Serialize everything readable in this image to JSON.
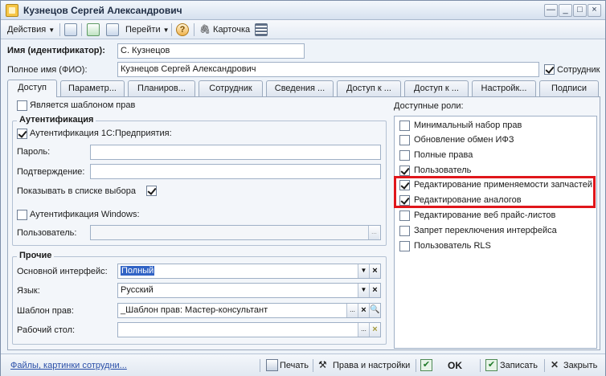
{
  "window": {
    "title": "Кузнецов Сергей Александрович",
    "controls": [
      "_",
      "□",
      "×"
    ],
    "extra_control": "—"
  },
  "toolbar": {
    "actions_label": "Действия",
    "goto_label": "Перейти",
    "card_label": "Карточка",
    "help_label": "?"
  },
  "header": {
    "name_label": "Имя (идентификатор):",
    "name_value": "С. Кузнецов",
    "fullname_label": "Полное имя (ФИО):",
    "fullname_value": "Кузнецов Сергей Александрович",
    "employee_label": "Сотрудник",
    "employee_checked": true
  },
  "tabs": [
    {
      "label": "Доступ",
      "active": true
    },
    {
      "label": "Параметр...",
      "active": false
    },
    {
      "label": "Планиров...",
      "active": false
    },
    {
      "label": "Сотрудник",
      "active": false
    },
    {
      "label": "Сведения ...",
      "active": false
    },
    {
      "label": "Доступ к ...",
      "active": false
    },
    {
      "label": "Доступ к ...",
      "active": false
    },
    {
      "label": "Настройк...",
      "active": false
    },
    {
      "label": "Подписи",
      "active": false
    }
  ],
  "access": {
    "template_label": "Является шаблоном прав",
    "template_checked": false,
    "auth_group_title": "Аутентификация",
    "auth_1c_label": "Аутентификация 1С:Предприятия:",
    "auth_1c_checked": true,
    "password_label": "Пароль:",
    "confirm_label": "Подтверждение:",
    "show_in_list_label": "Показывать в списке выбора",
    "show_in_list_checked": true,
    "auth_windows_label": "Аутентификация Windows:",
    "auth_windows_checked": false,
    "user_label": "Пользователь:",
    "user_btn": "..."
  },
  "other": {
    "group_title": "Прочие",
    "interface_label": "Основной интерфейс:",
    "interface_value": "Полный",
    "language_label": "Язык:",
    "language_value": "Русский",
    "rights_template_label": "Шаблон прав:",
    "rights_template_value": "_Шаблон прав: Мастер-консультант",
    "desktop_label": "Рабочий стол:",
    "desktop_value": "",
    "dots": "..."
  },
  "roles": {
    "title": "Доступные роли:",
    "items": [
      {
        "label": "Минимальный набор прав",
        "checked": false
      },
      {
        "label": "Обновление обмен ИФЗ",
        "checked": false
      },
      {
        "label": "Полные права",
        "checked": false
      },
      {
        "label": "Пользователь",
        "checked": true
      },
      {
        "label": "Редактирование применяемости запчастей",
        "checked": true
      },
      {
        "label": "Редактирование аналогов",
        "checked": true
      },
      {
        "label": "Редактирование веб прайс-листов",
        "checked": false
      },
      {
        "label": "Запрет переключения интерфейса",
        "checked": false
      },
      {
        "label": "Пользователь RLS",
        "checked": false
      }
    ]
  },
  "bottom": {
    "files_link": "Файлы, картинки сотрудни...",
    "print_label": "Печать",
    "rights_settings_label": "Права и настройки",
    "ok_label": "OK",
    "save_label": "Записать",
    "close_label": "Закрыть"
  },
  "colors": {
    "highlight": "#e0161b",
    "selection": "#3163c5",
    "link": "#2a4fa8"
  }
}
